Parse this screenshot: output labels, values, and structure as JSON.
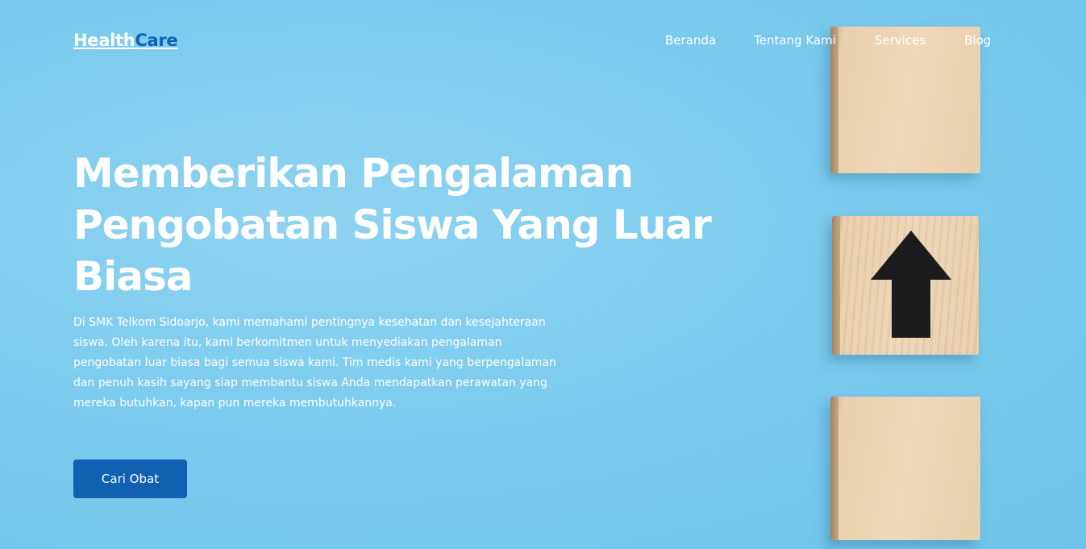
{
  "nav": {
    "logo": {
      "part1": "Health",
      "part2": "Care"
    },
    "items": [
      {
        "label": "Beranda"
      },
      {
        "label": "Tentang Kami"
      },
      {
        "label": "Services"
      },
      {
        "label": "Blog"
      }
    ]
  },
  "hero": {
    "title": "Memberikan Pengalaman Pengobatan Siswa Yang Luar Biasa",
    "description": "Di SMK Telkom Sidoarjo, kami memahami pentingnya kesehatan dan kesejahteraan siswa. Oleh karena itu, kami berkomitmen untuk menyediakan pengalaman pengobatan luar biasa bagi semua siswa kami. Tim medis kami yang berpengalaman dan penuh kasih sayang siap membantu siswa Anda mendapatkan perawatan yang mereka butuhkan, kapan pun mereka membutuhkannya.",
    "cta_label": "Cari Obat"
  },
  "colors": {
    "background": "#7ccbee",
    "accent": "#1560b0",
    "button": "#1160b1",
    "text": "#ffffff"
  },
  "icons": {
    "arrow": "arrow-up-icon"
  }
}
